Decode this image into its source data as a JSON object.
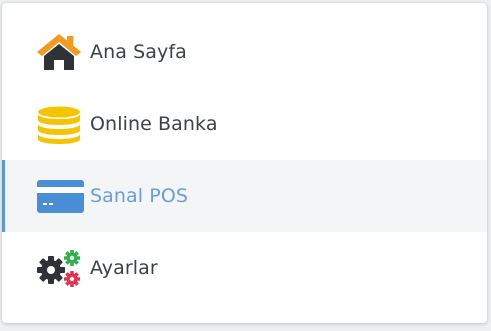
{
  "menu": {
    "items": [
      {
        "id": "home",
        "label": "Ana Sayfa",
        "icon": "home-icon",
        "active": false
      },
      {
        "id": "online-bank",
        "label": "Online Banka",
        "icon": "coins-icon",
        "active": false
      },
      {
        "id": "virtual-pos",
        "label": "Sanal POS",
        "icon": "credit-card-icon",
        "active": true
      },
      {
        "id": "settings",
        "label": "Ayarlar",
        "icon": "gears-icon",
        "active": false
      }
    ]
  },
  "colors": {
    "home_roof": "#f39a1f",
    "home_body": "#2f3337",
    "coins": "#f5c400",
    "card": "#4a8fd6",
    "active_text": "#6a9ed6",
    "active_bar": "#5b9bd5",
    "gear_main": "#2f3337",
    "gear_green": "#2fb24a",
    "gear_red": "#e5334e"
  }
}
